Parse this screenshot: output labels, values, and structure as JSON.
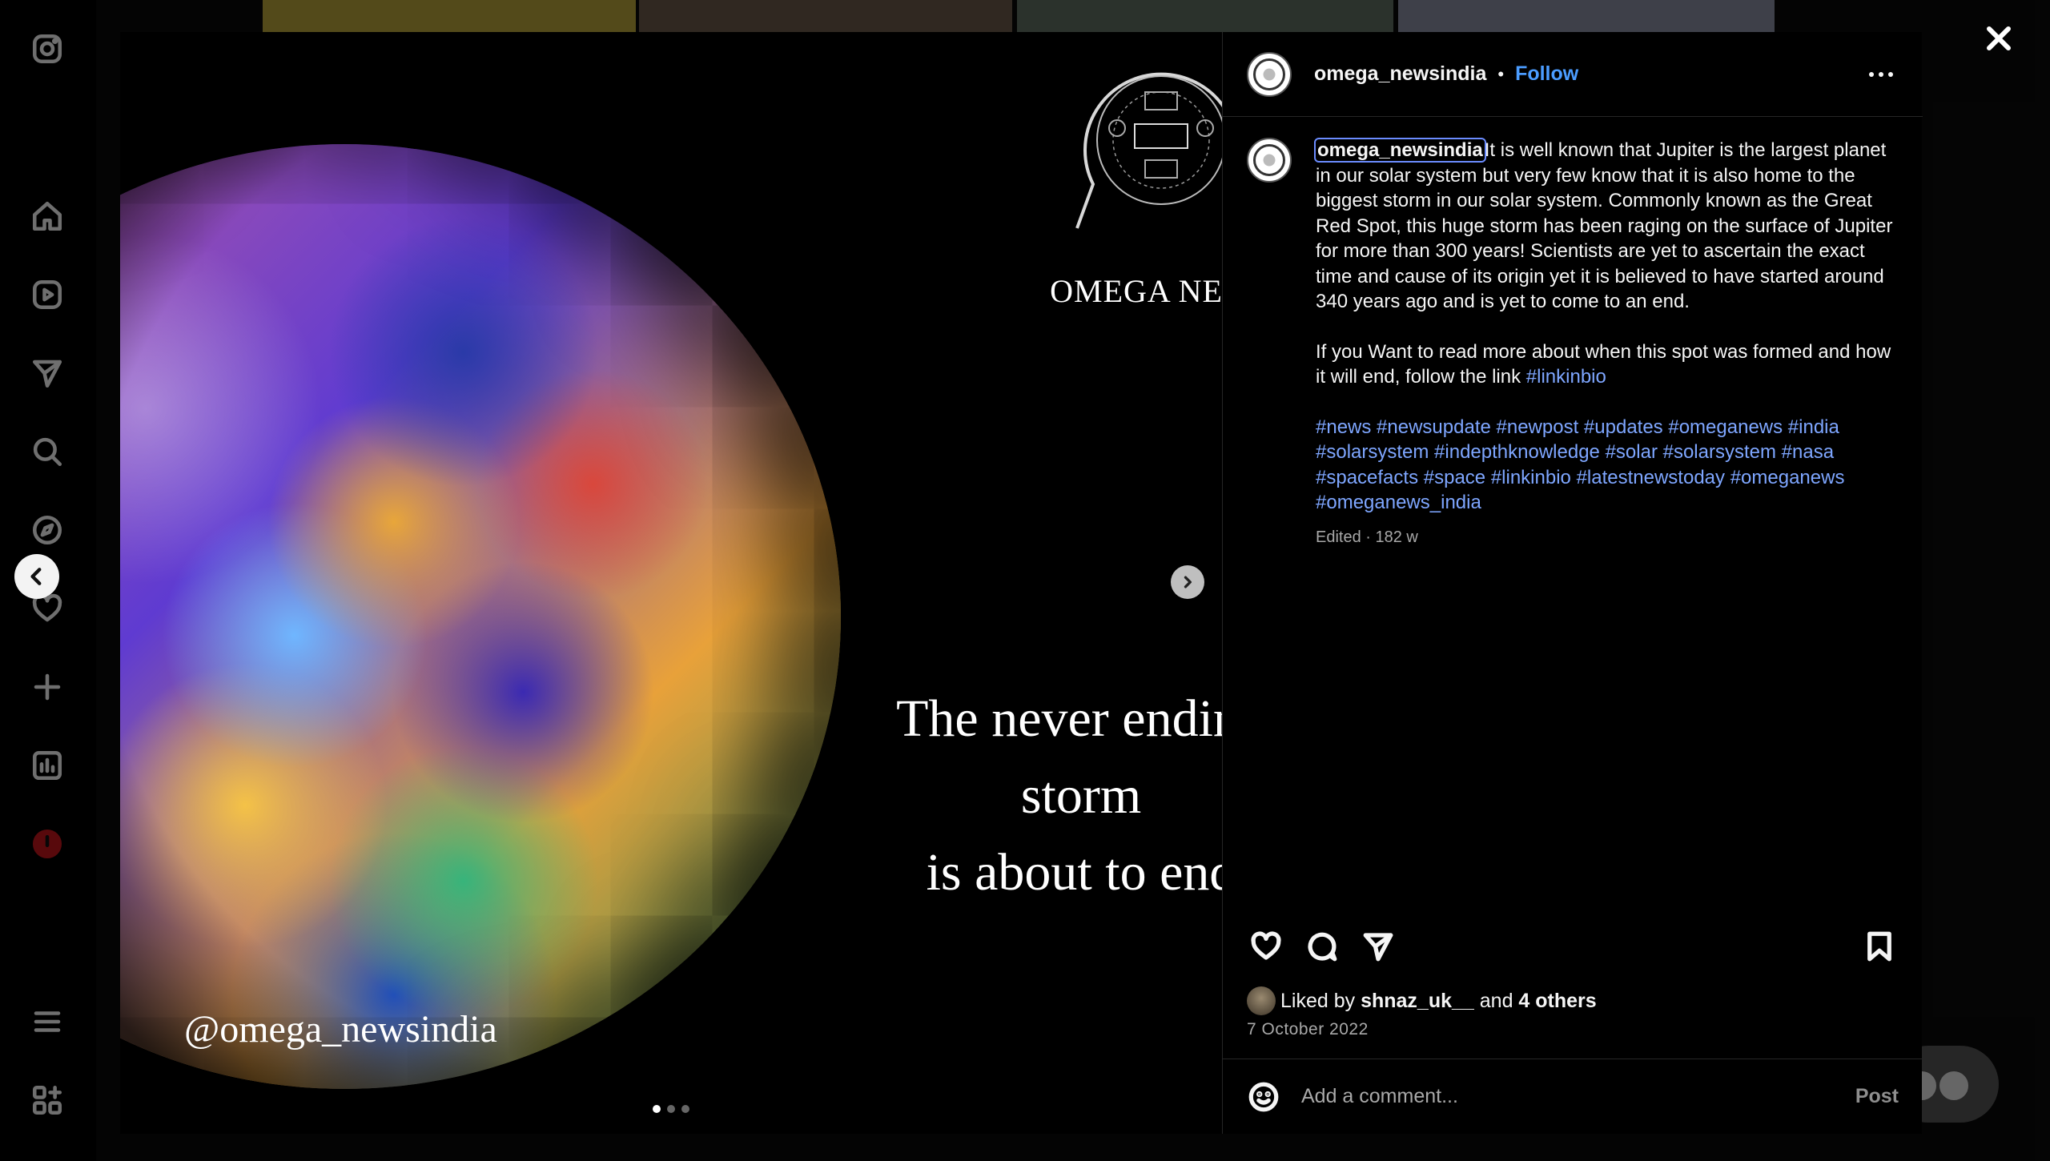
{
  "sidebar": {
    "icons": [
      "instagram-logo-icon",
      "home-icon",
      "reels-icon",
      "messages-icon",
      "search-icon",
      "explore-icon",
      "notifications-icon",
      "create-icon",
      "dashboard-icon",
      "profile-icon",
      "more-menu-icon",
      "also-from-meta-icon"
    ]
  },
  "post": {
    "header": {
      "username": "omega_newsindia",
      "separator": "•",
      "follow_label": "Follow"
    },
    "image": {
      "logo_text": "OMEGA NEWS",
      "headline_line1": "The never ending",
      "headline_line2": "storm",
      "headline_line3": "is about to end",
      "watermark": "@omega_newsindia",
      "slide_count": 3,
      "active_slide": 1
    },
    "caption": {
      "username": "omega_newsindia",
      "paragraph1": "It is well known that Jupiter is the largest planet in our solar system but very few know that it is also home to the biggest storm in our solar system. Commonly known as the Great Red Spot, this huge storm has been raging on the surface of Jupiter for more than 300 years! Scientists are yet to ascertain the exact time and cause of its origin yet it is believed to have started around 340 years ago and is yet to come to an end.",
      "paragraph2": "If you Want to read more about when this spot was formed and how it will end, follow the link ",
      "paragraph2_tag": "#linkinbio",
      "hashtags": [
        "#news",
        "#newsupdate",
        "#newpost",
        "#updates",
        "#omeganews",
        "#india",
        "#solarsystem",
        "#indepthknowledge",
        "#solar",
        "#solarsystem",
        "#nasa",
        "#spacefacts",
        "#space",
        "#linkinbio",
        "#latestnewstoday",
        "#omeganews",
        "#omeganews_india"
      ],
      "meta": "Edited · 182 w"
    },
    "likes": {
      "prefix": "Liked by ",
      "user": "shnaz_uk__",
      "middle": " and ",
      "others": "4 others"
    },
    "date": "7 October 2022",
    "comment": {
      "placeholder": "Add a comment...",
      "post_label": "Post"
    }
  },
  "colors": {
    "accent_link": "#4b9cff",
    "hashtag": "#7ea6ff",
    "background": "#000000",
    "secondary_text": "#a8a8a8"
  }
}
